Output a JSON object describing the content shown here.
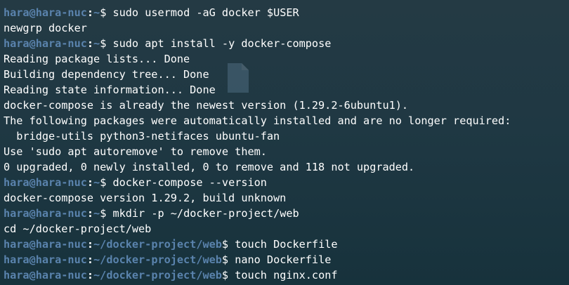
{
  "colors": {
    "prompt_user": "#5a83ad",
    "text": "#ffffff",
    "background": "#1f3843"
  },
  "lines": [
    {
      "type": "prompt",
      "user": "hara@hara-nuc",
      "path": "~",
      "command": "sudo usermod -aG docker $USER"
    },
    {
      "type": "output",
      "text": "newgrp docker"
    },
    {
      "type": "prompt",
      "user": "hara@hara-nuc",
      "path": "~",
      "command": "sudo apt install -y docker-compose"
    },
    {
      "type": "output",
      "text": "Reading package lists... Done"
    },
    {
      "type": "output",
      "text": "Building dependency tree... Done"
    },
    {
      "type": "output",
      "text": "Reading state information... Done"
    },
    {
      "type": "output",
      "text": "docker-compose is already the newest version (1.29.2-6ubuntu1)."
    },
    {
      "type": "output",
      "text": "The following packages were automatically installed and are no longer required:"
    },
    {
      "type": "output",
      "text": "  bridge-utils python3-netifaces ubuntu-fan"
    },
    {
      "type": "output",
      "text": "Use 'sudo apt autoremove' to remove them."
    },
    {
      "type": "output",
      "text": "0 upgraded, 0 newly installed, 0 to remove and 118 not upgraded."
    },
    {
      "type": "prompt",
      "user": "hara@hara-nuc",
      "path": "~",
      "command": "docker-compose --version"
    },
    {
      "type": "output",
      "text": "docker-compose version 1.29.2, build unknown"
    },
    {
      "type": "prompt",
      "user": "hara@hara-nuc",
      "path": "~",
      "command": "mkdir -p ~/docker-project/web"
    },
    {
      "type": "output",
      "text": "cd ~/docker-project/web"
    },
    {
      "type": "prompt",
      "user": "hara@hara-nuc",
      "path": "~/docker-project/web",
      "command": "touch Dockerfile"
    },
    {
      "type": "prompt",
      "user": "hara@hara-nuc",
      "path": "~/docker-project/web",
      "command": "nano Dockerfile"
    },
    {
      "type": "prompt",
      "user": "hara@hara-nuc",
      "path": "~/docker-project/web",
      "command": "touch nginx.conf"
    }
  ]
}
